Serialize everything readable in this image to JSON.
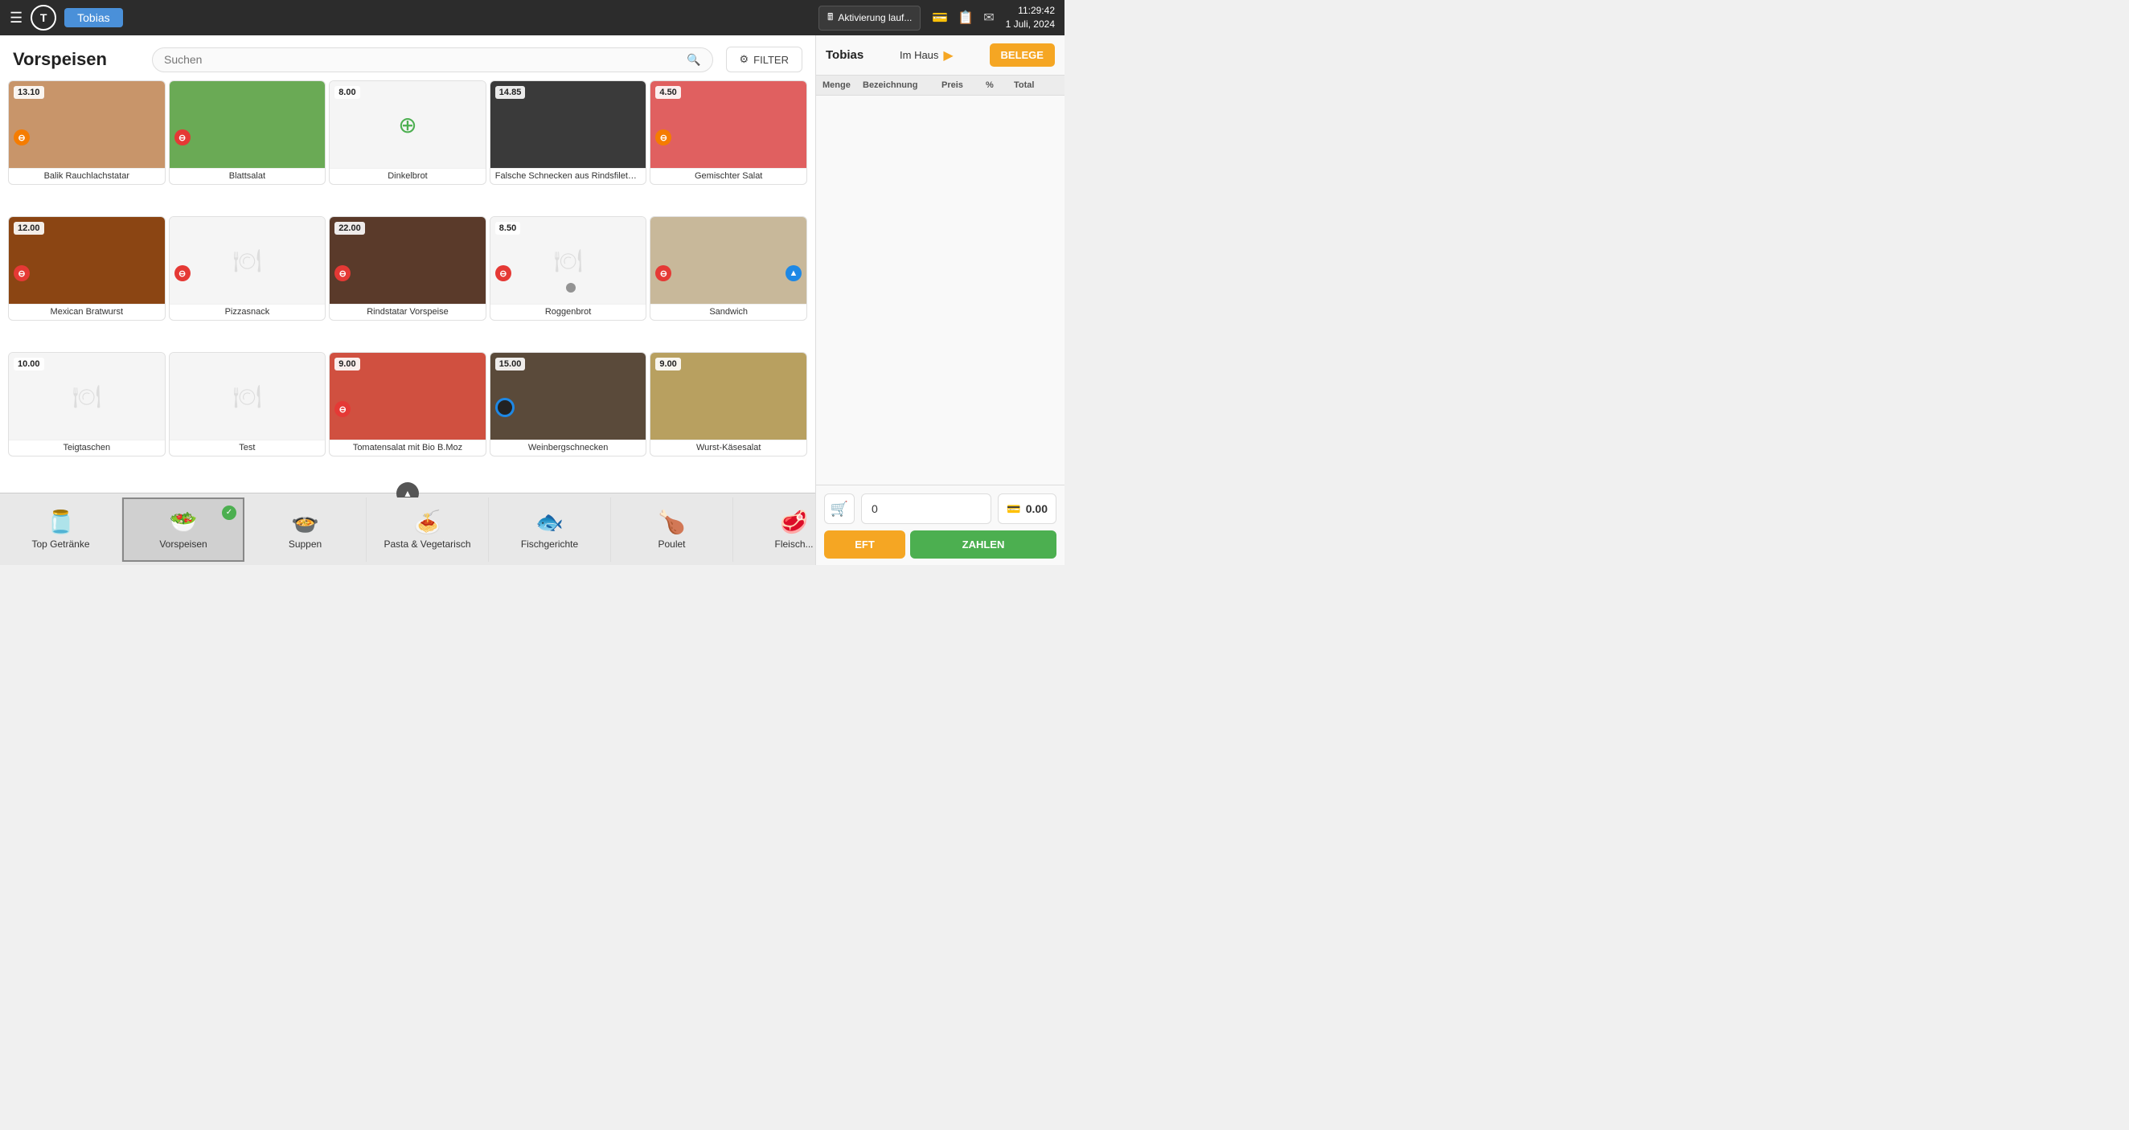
{
  "header": {
    "menu_icon": "☰",
    "logo_letter": "T",
    "user_name": "Tobias",
    "aktivierung_label": "Aktivierung lauf...",
    "time": "11:29:42",
    "date": "1 Juli, 2024"
  },
  "page": {
    "title": "Vorspeisen",
    "search_placeholder": "Suchen",
    "filter_label": "FILTER"
  },
  "items": [
    {
      "id": "balik",
      "name": "Balik Rauchlachstatar",
      "price": "13.10",
      "has_image": true,
      "badge": "orange",
      "badge_symbol": "⊖"
    },
    {
      "id": "blattsalat",
      "name": "Blattsalat",
      "price": "",
      "has_image": true,
      "badge": "red",
      "badge_symbol": "⊖"
    },
    {
      "id": "dinkelbrot",
      "name": "Dinkelbrot",
      "price": "8.00",
      "has_image": false,
      "special_icon": "⊕",
      "badge": null
    },
    {
      "id": "falsche-schnecken",
      "name": "Falsche Schnecken aus Rindsfiletwürfeln",
      "price": "14.85",
      "has_image": true,
      "badge": null
    },
    {
      "id": "gemischter-salat",
      "name": "Gemischter Salat",
      "price": "4.50",
      "has_image": true,
      "badge": "orange",
      "badge_symbol": "⊖"
    },
    {
      "id": "mexican-bratwurst",
      "name": "Mexican Bratwurst",
      "price": "12.00",
      "has_image": true,
      "badge": "red",
      "badge_symbol": "⊖"
    },
    {
      "id": "pizzasnack",
      "name": "Pizzasnack",
      "price": "",
      "has_image": false,
      "badge": "red",
      "badge_symbol": "⊖"
    },
    {
      "id": "rindstatar",
      "name": "Rindstatar Vorspeise",
      "price": "22.00",
      "has_image": true,
      "badge": "red",
      "badge_symbol": "⊖"
    },
    {
      "id": "roggenbrot",
      "name": "Roggenbrot",
      "price": "8.50",
      "has_image": false,
      "badge": "red",
      "badge_symbol": "⊖"
    },
    {
      "id": "sandwich",
      "name": "Sandwich",
      "price": "",
      "has_image": true,
      "badge_blue": true,
      "badge": "red",
      "badge_symbol": "⊖"
    },
    {
      "id": "teigtaschen",
      "name": "Teigtaschen",
      "price": "10.00",
      "has_image": false,
      "badge": null
    },
    {
      "id": "test",
      "name": "Test",
      "price": "",
      "has_image": false,
      "badge": null
    },
    {
      "id": "tomatensalat",
      "name": "Tomatensalat mit Bio B.Moz",
      "price": "9.00",
      "has_image": true,
      "badge": "red",
      "badge_symbol": "⊖"
    },
    {
      "id": "weinbergschnecken",
      "name": "Weinbergschnecken",
      "price": "15.00",
      "has_image": true,
      "badge": "dark",
      "badge_symbol": "◎"
    },
    {
      "id": "wurst-kasesalat",
      "name": "Wurst-Käsesalat",
      "price": "9.00",
      "has_image": true,
      "badge": null
    }
  ],
  "nav_categories": [
    {
      "id": "top-getraenke",
      "label": "Top Getränke",
      "icon": "🫙",
      "active": false,
      "checked": false
    },
    {
      "id": "vorspeisen",
      "label": "Vorspeisen",
      "icon": "🥗",
      "active": true,
      "checked": true
    },
    {
      "id": "suppen",
      "label": "Suppen",
      "icon": "🍲",
      "active": false,
      "checked": false
    },
    {
      "id": "pasta-vegetarisch",
      "label": "Pasta & Vegetarisch",
      "icon": "🍝",
      "active": false,
      "checked": false
    },
    {
      "id": "fischgerichte",
      "label": "Fischgerichte",
      "icon": "🐟",
      "active": false,
      "checked": false
    },
    {
      "id": "poulet",
      "label": "Poulet",
      "icon": "🍗",
      "active": false,
      "checked": false
    },
    {
      "id": "fleisch",
      "label": "Fleisch...",
      "icon": "🥩",
      "active": false,
      "checked": false
    }
  ],
  "right_panel": {
    "customer": "Tobias",
    "mode": "Im Haus",
    "belege_label": "BELEGE",
    "table_headers": [
      "Menge",
      "Bezeichnung",
      "Preis",
      "%",
      "Total"
    ],
    "cart_count": "0",
    "cart_total": "0.00",
    "eft_label": "EFT",
    "zahlen_label": "ZAHLEN"
  }
}
